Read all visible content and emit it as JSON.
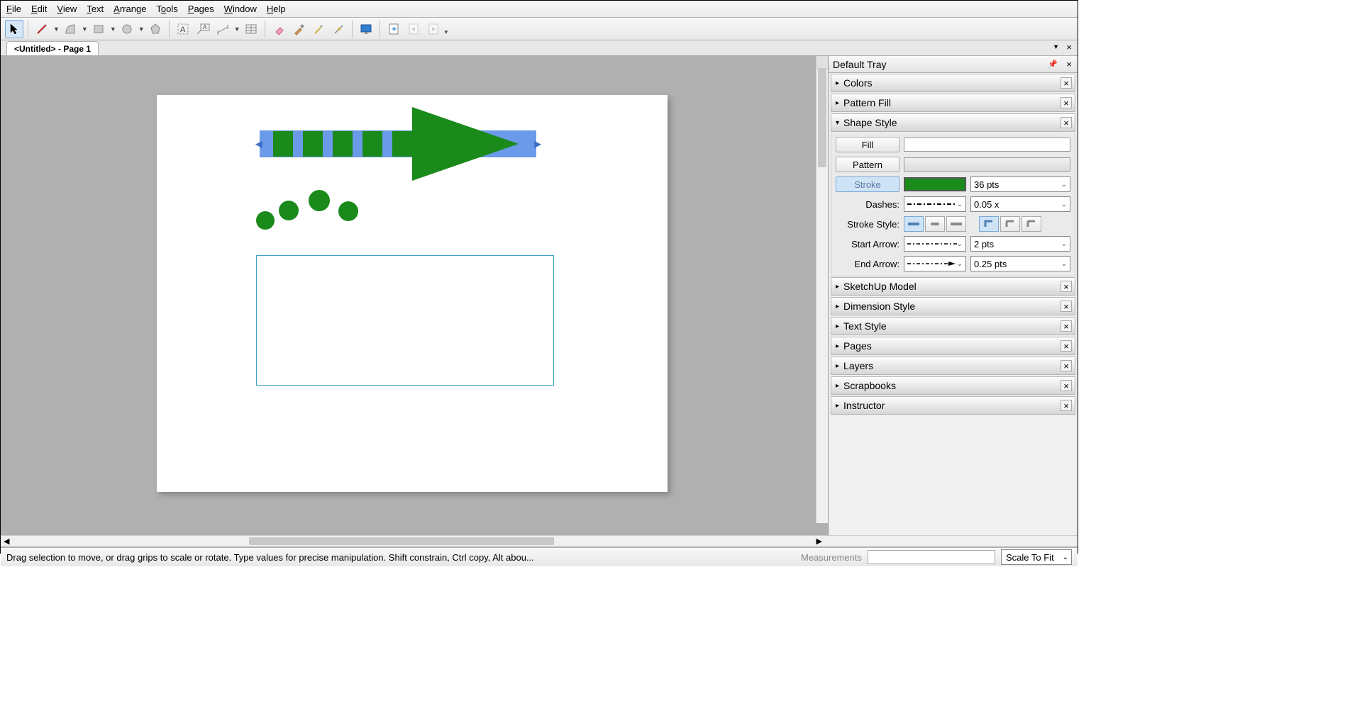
{
  "menu": [
    "File",
    "Edit",
    "View",
    "Text",
    "Arrange",
    "Tools",
    "Pages",
    "Window",
    "Help"
  ],
  "tab_title": "<Untitled> - Page 1",
  "tray_title": "Default Tray",
  "panels": {
    "colors": "Colors",
    "pattern_fill": "Pattern Fill",
    "shape_style": "Shape Style",
    "sketchup_model": "SketchUp Model",
    "dimension_style": "Dimension Style",
    "text_style": "Text Style",
    "pages": "Pages",
    "layers": "Layers",
    "scrapbooks": "Scrapbooks",
    "instructor": "Instructor"
  },
  "shape_style": {
    "fill_label": "Fill",
    "pattern_label": "Pattern",
    "stroke_label": "Stroke",
    "stroke_size": "36 pts",
    "dashes_label": "Dashes:",
    "dashes_scale": "0.05 x",
    "stroke_style_label": "Stroke Style:",
    "start_arrow_label": "Start Arrow:",
    "start_arrow_size": "2 pts",
    "end_arrow_label": "End Arrow:",
    "end_arrow_size": "0.25 pts"
  },
  "status": {
    "hint": "Drag selection to move, or drag grips to scale or rotate. Type values for precise manipulation. Shift constrain, Ctrl copy, Alt abou...",
    "measurements_label": "Measurements",
    "zoom": "Scale To Fit"
  },
  "colors": {
    "green": "#1a8a1a",
    "selection": "#6b9ae8",
    "teal": "#3aa0c0"
  }
}
